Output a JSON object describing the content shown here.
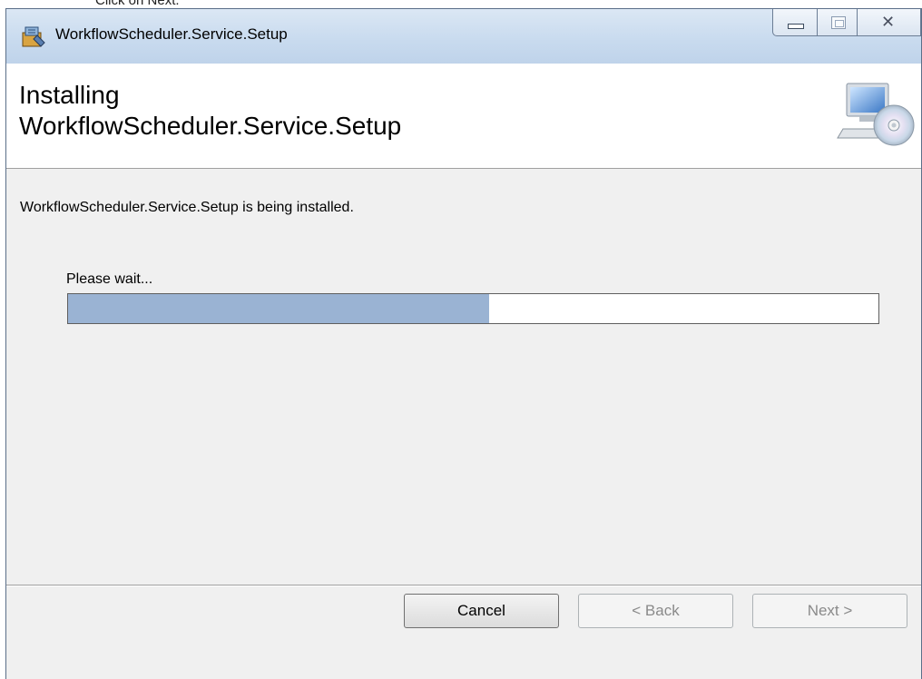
{
  "page_caption": "Click on Next.",
  "window": {
    "title": "WorkflowScheduler.Service.Setup",
    "icon": "installer-icon"
  },
  "header": {
    "title_line1": "Installing",
    "title_line2": "WorkflowScheduler.Service.Setup",
    "icon": "computer-cd-icon"
  },
  "body": {
    "status": "WorkflowScheduler.Service.Setup is being installed.",
    "wait_label": "Please wait...",
    "progress_fraction": 0.52
  },
  "buttons": {
    "cancel": "Cancel",
    "back": "< Back",
    "next": "Next >"
  },
  "colors": {
    "progress_fill": "#9ab3d3",
    "title_bar": "#c9dbef"
  }
}
